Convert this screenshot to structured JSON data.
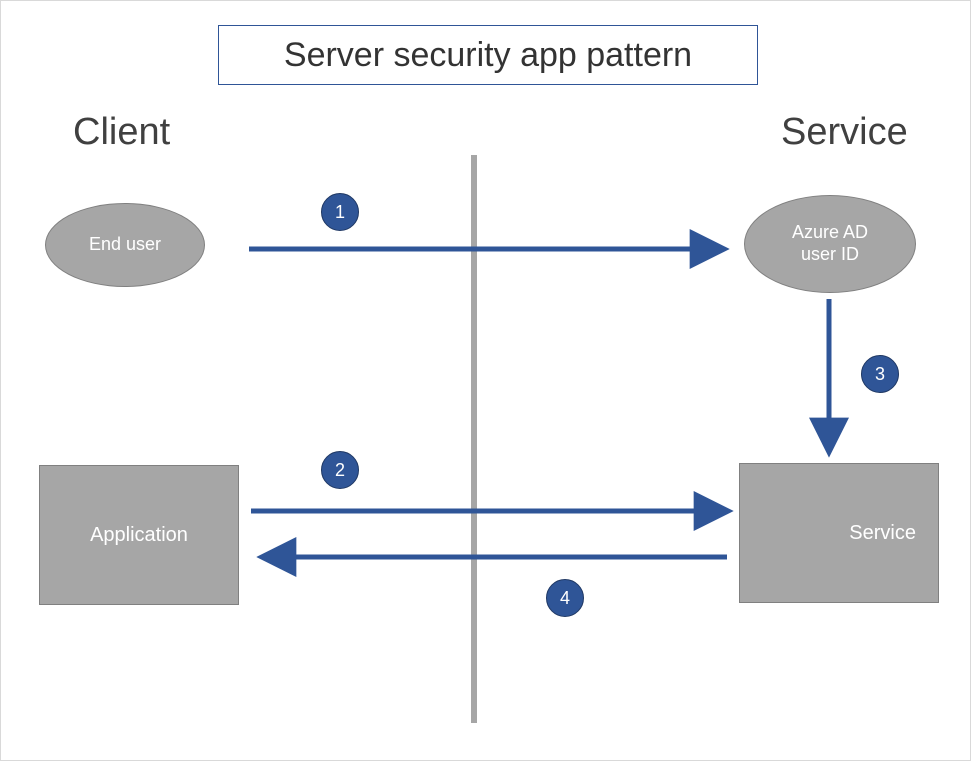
{
  "title": "Server security app pattern",
  "regions": {
    "client": "Client",
    "service": "Service"
  },
  "nodes": {
    "end_user": "End user",
    "azure_ad": "Azure AD\nuser ID",
    "application": "Application",
    "service_box": "Service"
  },
  "steps": {
    "s1": "1",
    "s2": "2",
    "s3": "3",
    "s4": "4"
  },
  "chart_data": {
    "type": "flow_diagram",
    "title": "Server security app pattern",
    "regions": [
      {
        "id": "client",
        "label": "Client",
        "side": "left"
      },
      {
        "id": "service",
        "label": "Service",
        "side": "right"
      }
    ],
    "nodes": [
      {
        "id": "end_user",
        "label": "End user",
        "shape": "ellipse",
        "region": "client"
      },
      {
        "id": "azure_ad",
        "label": "Azure AD user ID",
        "shape": "ellipse",
        "region": "service"
      },
      {
        "id": "application",
        "label": "Application",
        "shape": "rect",
        "region": "client"
      },
      {
        "id": "service_box",
        "label": "Service",
        "shape": "rect",
        "region": "service"
      }
    ],
    "edges": [
      {
        "step": 1,
        "from": "end_user",
        "to": "azure_ad",
        "direction": "right"
      },
      {
        "step": 2,
        "from": "application",
        "to": "service_box",
        "direction": "right"
      },
      {
        "step": 3,
        "from": "azure_ad",
        "to": "service_box",
        "direction": "down"
      },
      {
        "step": 4,
        "from": "service_box",
        "to": "application",
        "direction": "left"
      }
    ],
    "colors": {
      "accent": "#2f5597",
      "node_fill": "#a6a6a6",
      "node_text": "#ffffff"
    }
  }
}
